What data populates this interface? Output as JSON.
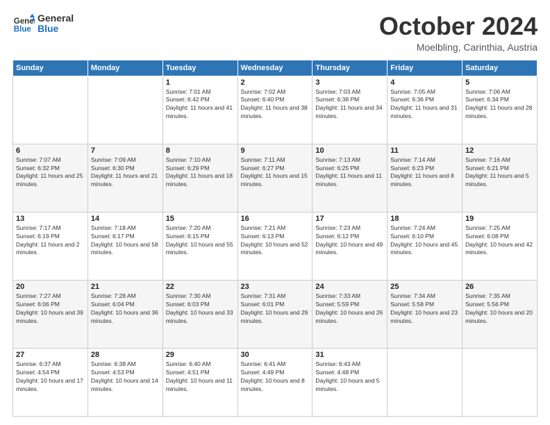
{
  "logo": {
    "line1": "General",
    "line2": "Blue"
  },
  "header": {
    "month": "October 2024",
    "location": "Moelbling, Carinthia, Austria"
  },
  "weekdays": [
    "Sunday",
    "Monday",
    "Tuesday",
    "Wednesday",
    "Thursday",
    "Friday",
    "Saturday"
  ],
  "weeks": [
    [
      {
        "day": "",
        "info": ""
      },
      {
        "day": "",
        "info": ""
      },
      {
        "day": "1",
        "info": "Sunrise: 7:01 AM\nSunset: 6:42 PM\nDaylight: 11 hours and 41 minutes."
      },
      {
        "day": "2",
        "info": "Sunrise: 7:02 AM\nSunset: 6:40 PM\nDaylight: 11 hours and 38 minutes."
      },
      {
        "day": "3",
        "info": "Sunrise: 7:03 AM\nSunset: 6:38 PM\nDaylight: 11 hours and 34 minutes."
      },
      {
        "day": "4",
        "info": "Sunrise: 7:05 AM\nSunset: 6:36 PM\nDaylight: 11 hours and 31 minutes."
      },
      {
        "day": "5",
        "info": "Sunrise: 7:06 AM\nSunset: 6:34 PM\nDaylight: 11 hours and 28 minutes."
      }
    ],
    [
      {
        "day": "6",
        "info": "Sunrise: 7:07 AM\nSunset: 6:32 PM\nDaylight: 11 hours and 25 minutes."
      },
      {
        "day": "7",
        "info": "Sunrise: 7:09 AM\nSunset: 6:30 PM\nDaylight: 11 hours and 21 minutes."
      },
      {
        "day": "8",
        "info": "Sunrise: 7:10 AM\nSunset: 6:29 PM\nDaylight: 11 hours and 18 minutes."
      },
      {
        "day": "9",
        "info": "Sunrise: 7:11 AM\nSunset: 6:27 PM\nDaylight: 11 hours and 15 minutes."
      },
      {
        "day": "10",
        "info": "Sunrise: 7:13 AM\nSunset: 6:25 PM\nDaylight: 11 hours and 11 minutes."
      },
      {
        "day": "11",
        "info": "Sunrise: 7:14 AM\nSunset: 6:23 PM\nDaylight: 11 hours and 8 minutes."
      },
      {
        "day": "12",
        "info": "Sunrise: 7:16 AM\nSunset: 6:21 PM\nDaylight: 11 hours and 5 minutes."
      }
    ],
    [
      {
        "day": "13",
        "info": "Sunrise: 7:17 AM\nSunset: 6:19 PM\nDaylight: 11 hours and 2 minutes."
      },
      {
        "day": "14",
        "info": "Sunrise: 7:18 AM\nSunset: 6:17 PM\nDaylight: 10 hours and 58 minutes."
      },
      {
        "day": "15",
        "info": "Sunrise: 7:20 AM\nSunset: 6:15 PM\nDaylight: 10 hours and 55 minutes."
      },
      {
        "day": "16",
        "info": "Sunrise: 7:21 AM\nSunset: 6:13 PM\nDaylight: 10 hours and 52 minutes."
      },
      {
        "day": "17",
        "info": "Sunrise: 7:23 AM\nSunset: 6:12 PM\nDaylight: 10 hours and 49 minutes."
      },
      {
        "day": "18",
        "info": "Sunrise: 7:24 AM\nSunset: 6:10 PM\nDaylight: 10 hours and 45 minutes."
      },
      {
        "day": "19",
        "info": "Sunrise: 7:25 AM\nSunset: 6:08 PM\nDaylight: 10 hours and 42 minutes."
      }
    ],
    [
      {
        "day": "20",
        "info": "Sunrise: 7:27 AM\nSunset: 6:06 PM\nDaylight: 10 hours and 39 minutes."
      },
      {
        "day": "21",
        "info": "Sunrise: 7:28 AM\nSunset: 6:04 PM\nDaylight: 10 hours and 36 minutes."
      },
      {
        "day": "22",
        "info": "Sunrise: 7:30 AM\nSunset: 6:03 PM\nDaylight: 10 hours and 33 minutes."
      },
      {
        "day": "23",
        "info": "Sunrise: 7:31 AM\nSunset: 6:01 PM\nDaylight: 10 hours and 29 minutes."
      },
      {
        "day": "24",
        "info": "Sunrise: 7:33 AM\nSunset: 5:59 PM\nDaylight: 10 hours and 26 minutes."
      },
      {
        "day": "25",
        "info": "Sunrise: 7:34 AM\nSunset: 5:58 PM\nDaylight: 10 hours and 23 minutes."
      },
      {
        "day": "26",
        "info": "Sunrise: 7:35 AM\nSunset: 5:56 PM\nDaylight: 10 hours and 20 minutes."
      }
    ],
    [
      {
        "day": "27",
        "info": "Sunrise: 6:37 AM\nSunset: 4:54 PM\nDaylight: 10 hours and 17 minutes."
      },
      {
        "day": "28",
        "info": "Sunrise: 6:38 AM\nSunset: 4:53 PM\nDaylight: 10 hours and 14 minutes."
      },
      {
        "day": "29",
        "info": "Sunrise: 6:40 AM\nSunset: 4:51 PM\nDaylight: 10 hours and 11 minutes."
      },
      {
        "day": "30",
        "info": "Sunrise: 6:41 AM\nSunset: 4:49 PM\nDaylight: 10 hours and 8 minutes."
      },
      {
        "day": "31",
        "info": "Sunrise: 6:43 AM\nSunset: 4:48 PM\nDaylight: 10 hours and 5 minutes."
      },
      {
        "day": "",
        "info": ""
      },
      {
        "day": "",
        "info": ""
      }
    ]
  ]
}
